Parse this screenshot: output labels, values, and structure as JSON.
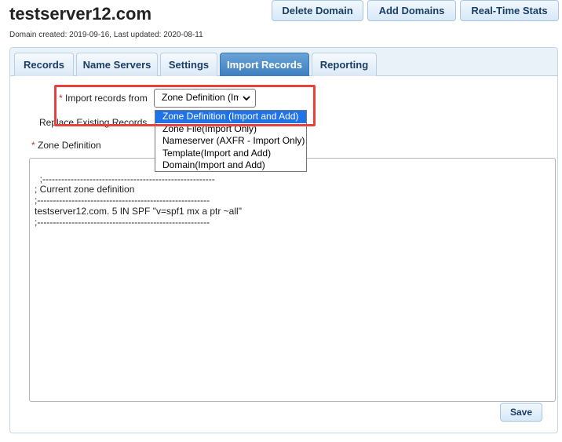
{
  "header": {
    "domain": "testserver12.com",
    "meta": "Domain created: 2019-09-16, Last updated: 2020-08-11",
    "buttons": {
      "delete": "Delete Domain",
      "add": "Add Domains",
      "realtime": "Real-Time Stats"
    }
  },
  "tabs": {
    "records": "Records",
    "nameservers": "Name Servers",
    "settings": "Settings",
    "import": "Import Records",
    "reporting": "Reporting",
    "active": "Import Records"
  },
  "form": {
    "required_mark": "*",
    "import_label": "Import records from",
    "import_selected": "Zone Definition (Im",
    "replace_label": "Replace Existing Records",
    "zone_label": "Zone Definition",
    "options": [
      "Zone Definition (Import and Add)",
      "Zone File(Import Only)",
      "Nameserver (AXFR - Import Only)",
      "Template(Import and Add)",
      "Domain(Import and Add)"
    ],
    "zone_text": ";-------------------------------------------------------\n; Current zone definition\n;-------------------------------------------------------\ntestserver12.com. 5 IN SPF \"v=spf1 mx a ptr ~all\"\n;-------------------------------------------------------",
    "save": "Save"
  },
  "colors": {
    "accent": "#3d7fc0",
    "highlight": "#e8423f",
    "selected_option": "#1e73e8"
  }
}
